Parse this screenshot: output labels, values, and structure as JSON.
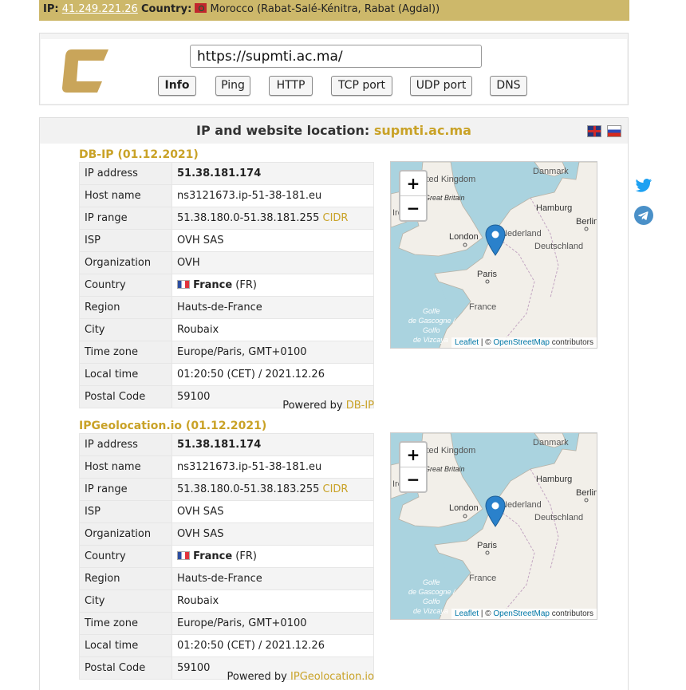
{
  "topbar": {
    "ip_label": "IP",
    "ip_value": "41.249.221.26",
    "country_label": "Country",
    "country_value": "Morocco (Rabat-Salé-Kénitra, Rabat (Agdal))"
  },
  "header": {
    "url_value": "https://supmti.ac.ma/",
    "buttons": [
      "Info",
      "Ping",
      "HTTP",
      "TCP port",
      "UDP port",
      "DNS"
    ],
    "active_button": "Info"
  },
  "main": {
    "title_prefix": "IP and website location:",
    "title_domain": "supmti.ac.ma"
  },
  "sections": [
    {
      "title": "DB-IP (01.12.2021)",
      "rows": [
        {
          "k": "IP address",
          "v": "51.38.181.174"
        },
        {
          "k": "Host name",
          "v": "ns3121673.ip-51-38-181.eu"
        },
        {
          "k": "IP range",
          "v": "51.38.180.0-51.38.181.255",
          "extra": "CIDR"
        },
        {
          "k": "ISP",
          "v": "OVH SAS"
        },
        {
          "k": "Organization",
          "v": "OVH"
        },
        {
          "k": "Country",
          "v": "France",
          "extra": "(FR)"
        },
        {
          "k": "Region",
          "v": "Hauts-de-France"
        },
        {
          "k": "City",
          "v": "Roubaix"
        },
        {
          "k": "Time zone",
          "v": "Europe/Paris, GMT+0100"
        },
        {
          "k": "Local time",
          "v": "01:20:50 (CET) / 2021.12.26"
        },
        {
          "k": "Postal Code",
          "v": "59100"
        }
      ],
      "powered_label": "Powered by",
      "powered_link": "DB-IP"
    },
    {
      "title": "IPGeolocation.io (01.12.2021)",
      "rows": [
        {
          "k": "IP address",
          "v": "51.38.181.174"
        },
        {
          "k": "Host name",
          "v": "ns3121673.ip-51-38-181.eu"
        },
        {
          "k": "IP range",
          "v": "51.38.180.0-51.38.183.255",
          "extra": "CIDR"
        },
        {
          "k": "ISP",
          "v": "OVH SAS"
        },
        {
          "k": "Organization",
          "v": "OVH SAS"
        },
        {
          "k": "Country",
          "v": "France",
          "extra": "(FR)"
        },
        {
          "k": "Region",
          "v": "Hauts-de-France"
        },
        {
          "k": "City",
          "v": "Roubaix"
        },
        {
          "k": "Time zone",
          "v": "Europe/Paris, GMT+0100"
        },
        {
          "k": "Local time",
          "v": "01:20:50 (CET) / 2021.12.26"
        },
        {
          "k": "Postal Code",
          "v": "59100"
        }
      ],
      "powered_label": "Powered by",
      "powered_link": "IPGeolocation.io"
    }
  ],
  "map": {
    "zoom_in": "+",
    "zoom_out": "−",
    "labels": [
      "United Kingdom",
      "Great Britain",
      "Ireland",
      "London",
      "Nederland",
      "Danmark",
      "Hamburg",
      "Berlin",
      "Deutschland",
      "Paris",
      "France",
      "Golfe de Gascogne / Golfo de Vizcaya"
    ],
    "attribution_leaflet": "Leaflet",
    "attribution_sep": " | © ",
    "attribution_osm": "OpenStreetMap",
    "attribution_tail": " contributors"
  },
  "colors": {
    "accent": "#c9a227",
    "topbar": "#cdb86a",
    "marker": "#2a81cb",
    "water": "#aad3df",
    "land": "#f2efe9"
  },
  "icons": [
    "twitter-icon",
    "telegram-icon",
    "map-marker-icon",
    "flag-gb-icon",
    "flag-ru-icon",
    "flag-fr-icon",
    "flag-ma-icon",
    "logo-icon"
  ]
}
